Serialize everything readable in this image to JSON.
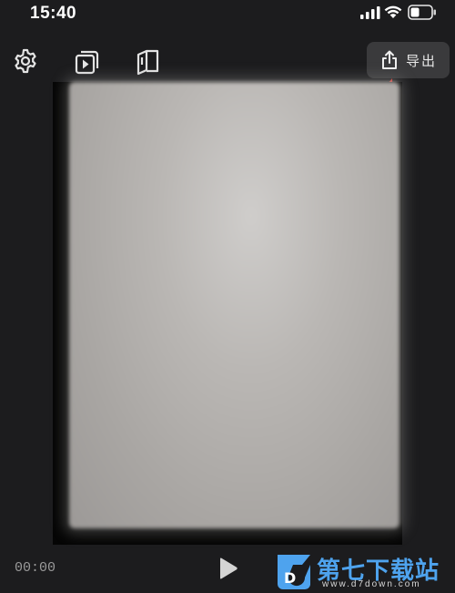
{
  "status_bar": {
    "time": "15:40",
    "icons": [
      "signal-icon",
      "wifi-icon",
      "battery-icon"
    ]
  },
  "toolbar": {
    "icons": [
      "gear-icon",
      "preview-icon",
      "book-icon"
    ],
    "export": {
      "icon": "share-upload-icon",
      "label": "导出"
    }
  },
  "annotation": {
    "type": "arrow",
    "color": "#e5312b"
  },
  "player": {
    "current_time": "00:00",
    "play_icon": "play-icon"
  },
  "watermark": {
    "title": "第七下载站",
    "url": "www.d7down.com",
    "color": "#4ea3ee"
  },
  "colors": {
    "background": "#1c1c1e",
    "export_button": "#3a3a3c",
    "page": "#c4c1be"
  }
}
